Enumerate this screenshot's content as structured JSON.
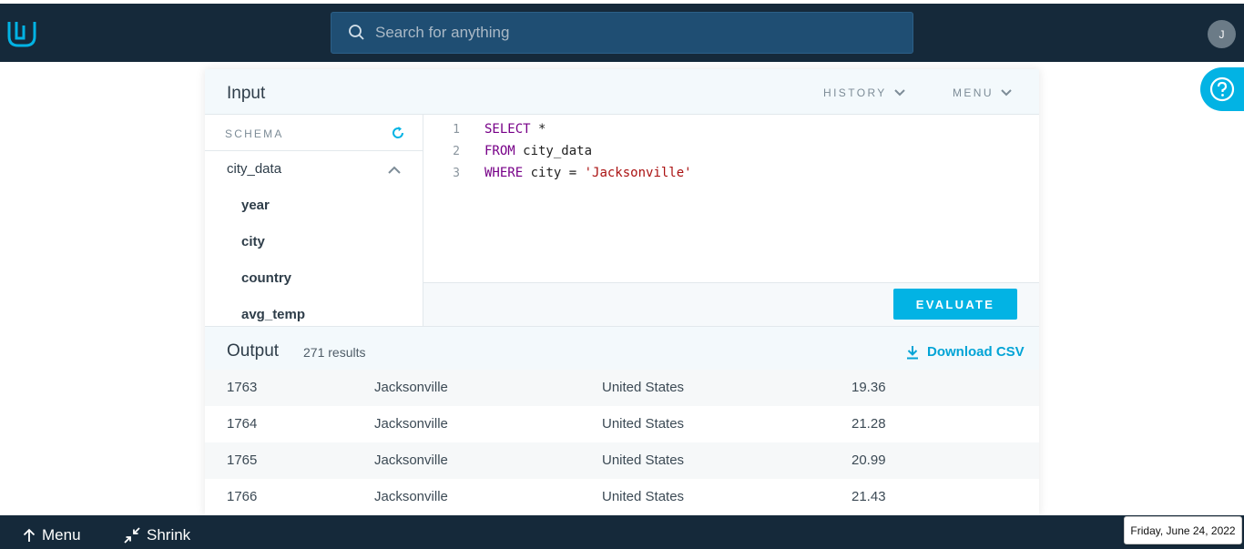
{
  "header": {
    "logo_icon": "udacity-logo-icon",
    "search_placeholder": "Search for anything",
    "avatar_initial": "J"
  },
  "help_icon": "question-circle-icon",
  "input": {
    "title": "Input",
    "history_label": "HISTORY",
    "menu_label": "MENU"
  },
  "schema": {
    "label": "SCHEMA",
    "table_name": "city_data",
    "columns": [
      "year",
      "city",
      "country",
      "avg_temp"
    ]
  },
  "editor": {
    "lines": [
      {
        "num": "1",
        "keyword": "SELECT",
        "rest": " *",
        "string": ""
      },
      {
        "num": "2",
        "keyword": "FROM",
        "rest": " city_data",
        "string": ""
      },
      {
        "num": "3",
        "keyword": "WHERE",
        "rest": " city = ",
        "string": "'Jacksonville'"
      }
    ],
    "evaluate_label": "EVALUATE"
  },
  "output": {
    "title": "Output",
    "result_count": "271 results",
    "download_label": "Download CSV",
    "rows": [
      [
        "1763",
        "Jacksonville",
        "United States",
        "19.36"
      ],
      [
        "1764",
        "Jacksonville",
        "United States",
        "21.28"
      ],
      [
        "1765",
        "Jacksonville",
        "United States",
        "20.99"
      ],
      [
        "1766",
        "Jacksonville",
        "United States",
        "21.43"
      ]
    ]
  },
  "bottom": {
    "menu_label": "Menu",
    "shrink_label": "Shrink",
    "date": "Friday, June 24, 2022"
  },
  "colors": {
    "topbar": "#15293a",
    "accent": "#02b3e4",
    "keyword": "#770088",
    "string": "#aa1111"
  }
}
